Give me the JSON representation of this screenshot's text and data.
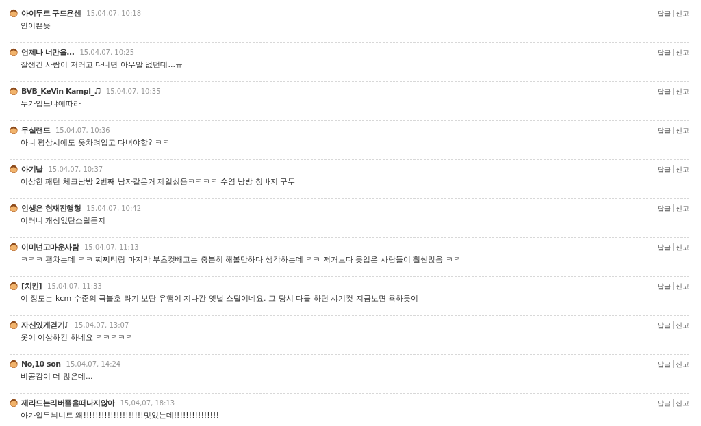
{
  "comments": [
    {
      "author": "아이두르 구드욘센",
      "date": "15,04,07, 10:18",
      "text": "안이쁜옷",
      "actions": [
        "답글",
        "신고"
      ]
    },
    {
      "author": "언제나 너만을...",
      "date": "15,04,07, 10:25",
      "text": "잘생긴 사람이 저러고 다니면 아무말 없던데...ㅠ",
      "actions": [
        "답글",
        "신고"
      ]
    },
    {
      "author": "BVB_KeVin Kampl_♬",
      "date": "15,04,07, 10:35",
      "text": "누가입느냐에따라",
      "actions": [
        "답글",
        "신고"
      ]
    },
    {
      "author": "무실랜드",
      "date": "15,04,07, 10:36",
      "text": "아니 평상시에도 옷차려입고 다녀야함? ㅋㅋ",
      "actions": [
        "답글",
        "신고"
      ]
    },
    {
      "author": "아기날",
      "date": "15,04,07, 10:37",
      "text": "이상한 패턴 체크남방 2번째 남자같은거 제일싫음ㅋㅋㅋㅋ 수염 남방 청바지 구두",
      "actions": [
        "답글",
        "신고"
      ]
    },
    {
      "author": "인생은 현재진행형",
      "date": "15,04,07, 10:42",
      "text": "이러니 개성없단소릴듣지",
      "actions": [
        "답글",
        "신고"
      ]
    },
    {
      "author": "이미넌고마운사람",
      "date": "15,04,07, 11:13",
      "text": "ㅋㅋㅋ 괜차는데 ㅋㅋ 찌찌티링 마지막 부츠컷빼고는 충분히 해볼만하다 생각하는데 ㅋㅋ 저거보다 못입은 사람들이 훨씬많음 ㅋㅋ",
      "actions": [
        "답글",
        "신고"
      ]
    },
    {
      "author": "[치킨]",
      "date": "15,04,07, 11:33",
      "text": "이 정도는 kcm 수준의 극불호 라기 보단 유행이 지나간 옛날 스탈이네요. 그 당시 다들 하던 샤기컷 지금보면 욕하듯이",
      "actions": [
        "답글",
        "신고"
      ]
    },
    {
      "author": "자신있게걷기♪",
      "date": "15,04,07, 13:07",
      "text": "옷이 이상하긴 하네요 ㅋㅋㅋㅋㅋ",
      "actions": [
        "답글",
        "신고"
      ]
    },
    {
      "author": "No,10 son",
      "date": "15,04,07, 14:24",
      "text": "비공감이 더 많은데...",
      "actions": [
        "답글",
        "신고"
      ]
    },
    {
      "author": "제라드는리버풀을떠나지않아",
      "date": "15,04,07, 18:13",
      "text": "아가일무늬니트 왜!!!!!!!!!!!!!!!!!!!!멋있는데!!!!!!!!!!!!!!!",
      "actions": [
        "답글",
        "신고"
      ]
    }
  ]
}
